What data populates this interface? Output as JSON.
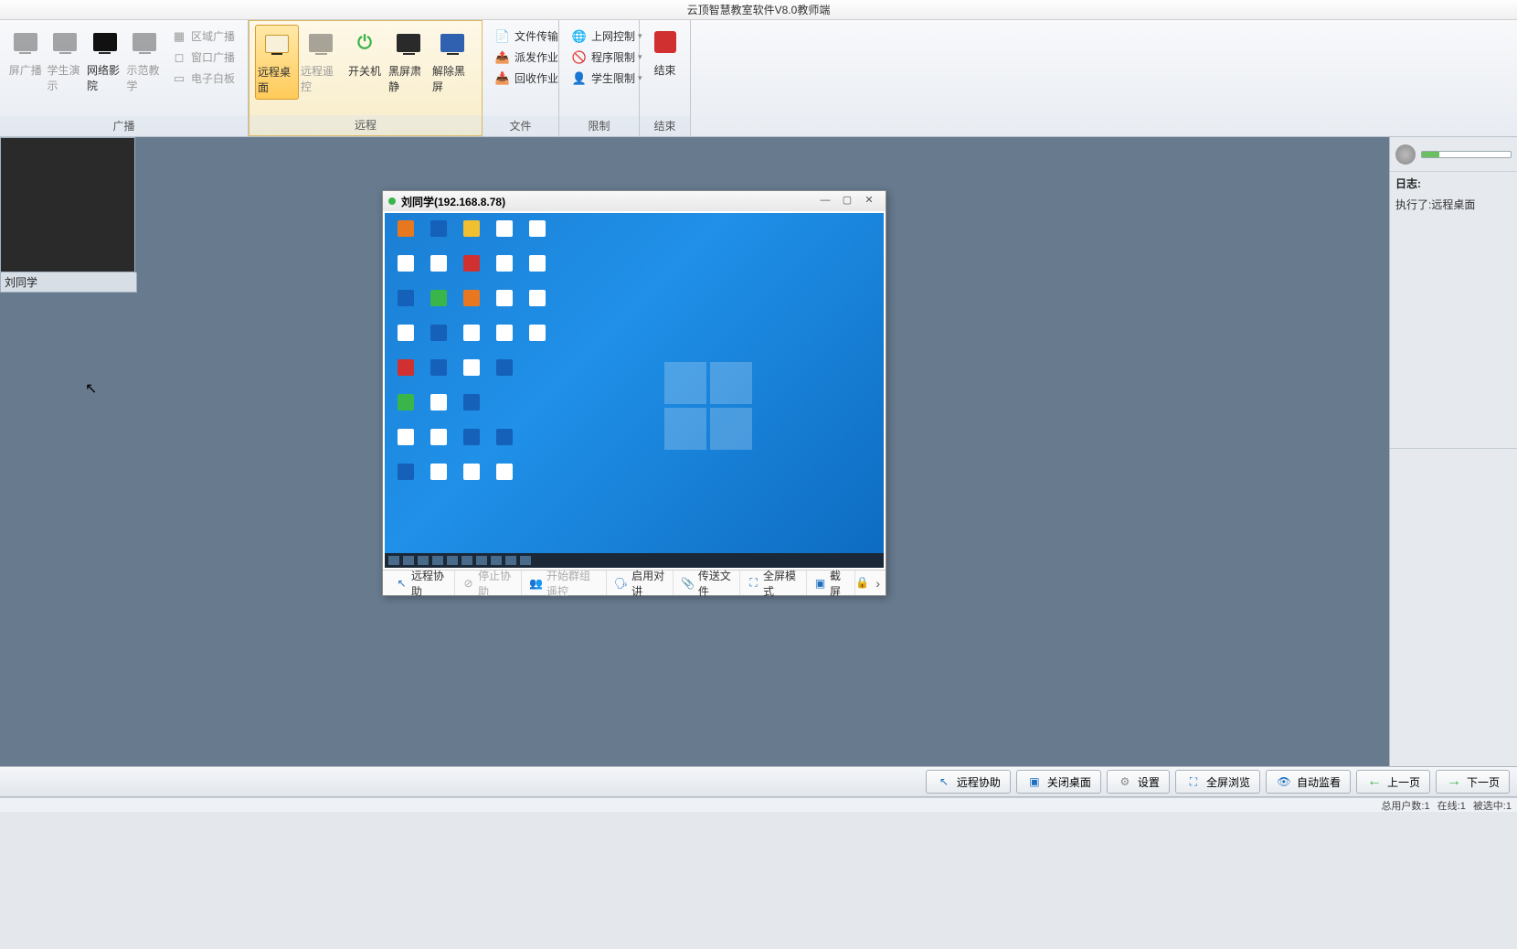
{
  "app_title": "云顶智慧教室软件V8.0教师端",
  "ribbon": {
    "group_broadcast": {
      "label": "广播",
      "items": {
        "screen_broadcast": "屏广播",
        "student_demo": "学生演示",
        "network_theater": "网络影院",
        "demo_teaching": "示范教学",
        "region_broadcast": "区域广播",
        "window_broadcast": "窗口广播",
        "whiteboard": "电子白板"
      }
    },
    "group_remote": {
      "label": "远程",
      "items": {
        "remote_desktop": "远程桌面",
        "remote_control": "远程遥控",
        "power": "开关机",
        "black_screen": "黑屏肃静",
        "unblack": "解除黑屏"
      }
    },
    "group_file": {
      "label": "文件",
      "items": {
        "file_transfer": "文件传输",
        "send_homework": "派发作业",
        "collect_homework": "回收作业"
      }
    },
    "group_limit": {
      "label": "限制",
      "items": {
        "net_control": "上网控制",
        "program_limit": "程序限制",
        "student_limit": "学生限制"
      }
    },
    "group_end": {
      "label": "结束",
      "button": "结束"
    }
  },
  "student": {
    "name": "刘同学"
  },
  "remote_window": {
    "title": "刘同学(192.168.8.78)",
    "toolbar": {
      "remote_assist": "远程协助",
      "stop_assist": "停止协助",
      "group_control": "开始群组遥控",
      "enable_talk": "启用对讲",
      "send_file": "传送文件",
      "fullscreen": "全屏模式",
      "screenshot": "截屏"
    }
  },
  "log": {
    "title": "日志:",
    "line1": "执行了:远程桌面"
  },
  "bottom_toolbar": {
    "remote_assist": "远程协助",
    "close_desktop": "关闭桌面",
    "settings": "设置",
    "fullscreen_browse": "全屏浏览",
    "auto_monitor": "自动监看",
    "prev_page": "上一页",
    "next_page": "下一页"
  },
  "status": {
    "total_users_label": "总用户数:",
    "total_users": "1",
    "online_label": "在线:",
    "online": "1",
    "selected_label": "被选中:",
    "selected": "1"
  }
}
